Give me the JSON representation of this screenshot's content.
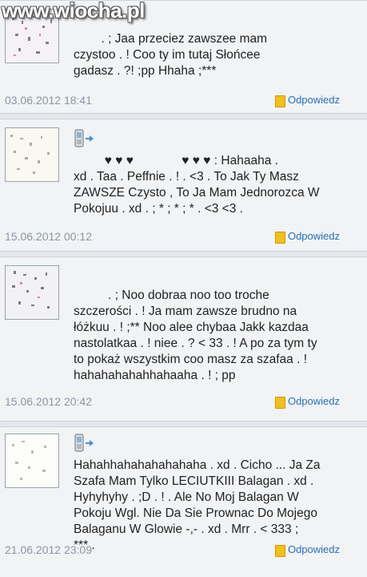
{
  "watermark": "www.wiocha.pl",
  "comments": [
    {
      "message": "        . ; Jaa przeciez zawszee mam\nczystoo . ! Coo ty im tutaj Słońcee\ngadasz . ?! ;pp Hhaha ;***",
      "date": "03.06.2012 18:41",
      "reply_label": "Odpowiedz",
      "mobile": false
    },
    {
      "message": "         ♥ ♥ ♥              ♥ ♥ ♥ : Hahaaha .\nxd . Taa . Peffnie . ! . <3 . To Jak Ty Masz\nZAWSZE Czysto , To Ja Mam Jednorozca W\nPokojuu . xd . ; * ; * ; * . <3 <3 .",
      "date": "15.06.2012 00:12",
      "reply_label": "Odpowiedz",
      "mobile": true
    },
    {
      "message": "          . ; Noo dobraa noo too troche\nszczerości . ! Ja mam zawsze brudno na\nłóżkuu . ! ;** Noo alee chybaa Jakk kazdaa\nnastolatkaa . ! niee . ? < 33 . ! A po za tym ty\nto pokaż wszystkim coo masz za szafaa . !\nhahahahahahhahaaha . ! ; pp",
      "date": "15.06.2012 20:42",
      "reply_label": "Odpowiedz",
      "mobile": false
    },
    {
      "message": "Hahahhahahahahahaha . xd . Cicho ... Ja Za\nSzafa Mam Tylko LECIUTKIII Balagan . xd .\nHyhyhyhy . ;D . ! . Ale No Moj Balagan W\nPokoju Wgl. Nie Da Sie Prownac Do Mojego\nBalaganu W Glowie -,- . xd . Mrr . < 333 ;\n*** .",
      "date": "21.06.2012 23:09",
      "reply_label": "Odpowiedz",
      "mobile": true
    }
  ]
}
